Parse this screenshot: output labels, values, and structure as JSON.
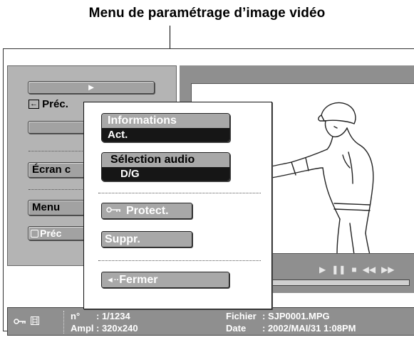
{
  "caption": "Menu de paramétrage d’image vidéo",
  "left_panel": {
    "play_arrow": "►",
    "prev_arrow": "←",
    "prev_label": "Préc.",
    "screen_label": "Écran c",
    "menu_label": "Menu",
    "prev2_label": "Préc"
  },
  "popup": {
    "information": {
      "label": "Informations",
      "value": "Act."
    },
    "audio": {
      "label": "Sélection audio",
      "value": "D/G"
    },
    "protect_label": "Protect.",
    "delete_label": "Suppr.",
    "close_label": "Fermer",
    "close_arrow": "◄··"
  },
  "transport": {
    "play": "▶",
    "pause": "❚❚",
    "stop": "■",
    "rewind": "◀◀",
    "forward": "▶▶"
  },
  "info": {
    "number_label": "n°",
    "number_value": ": 1/1234",
    "size_label": "Ampl",
    "size_value": ": 320x240",
    "file_label": "Fichier",
    "file_value": ": SJP0001.MPG",
    "date_label": "Date",
    "date_value": ": 2002/MAI/31  1:08PM"
  }
}
